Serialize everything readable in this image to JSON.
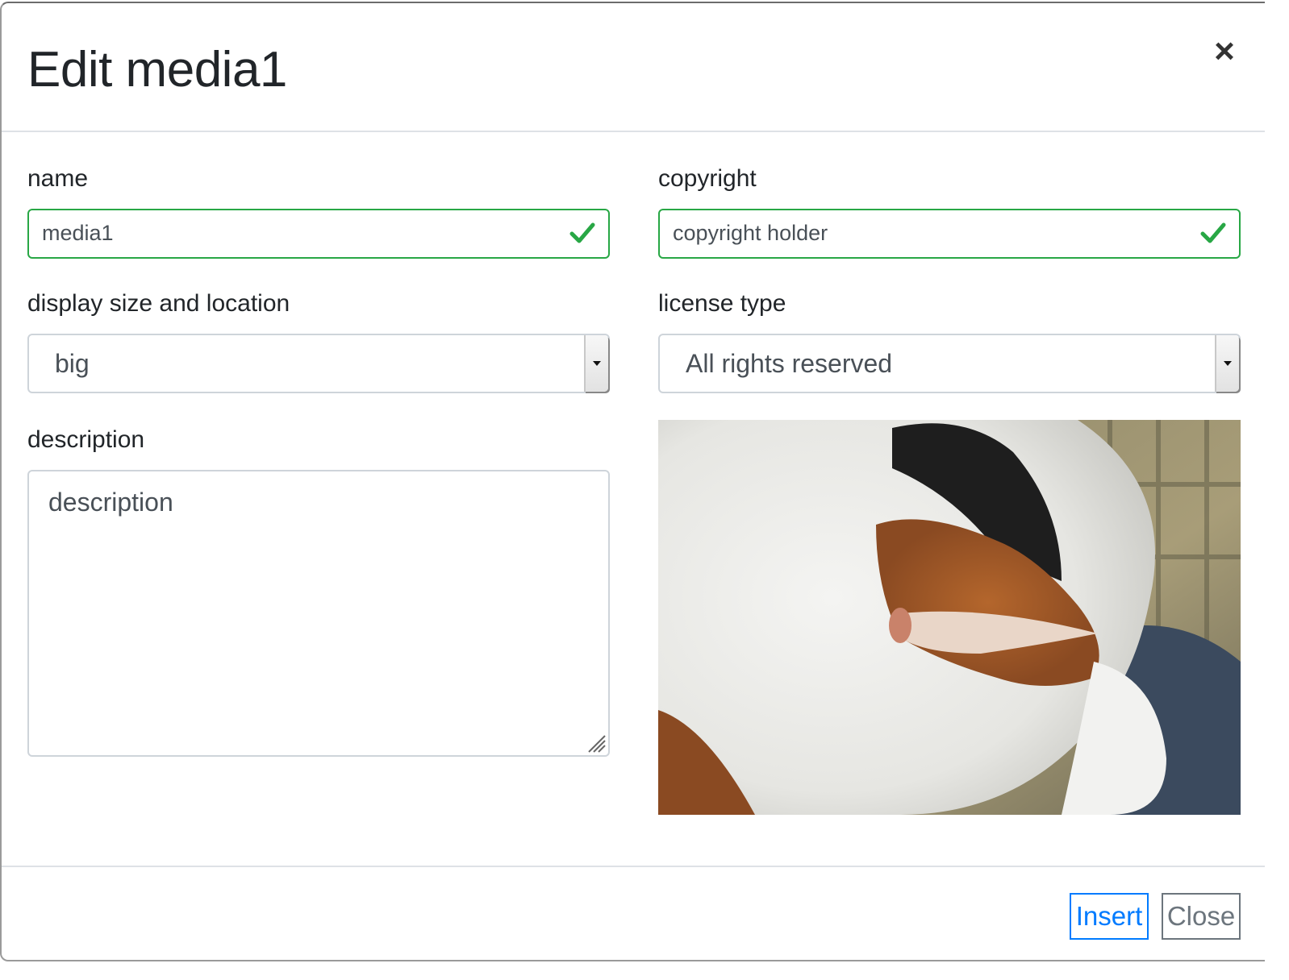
{
  "modal": {
    "title": "Edit media1",
    "close_icon": "close-icon"
  },
  "form": {
    "name": {
      "label": "name",
      "value": "media1",
      "status": "valid"
    },
    "copyright": {
      "label": "copyright",
      "value": "copyright holder",
      "status": "valid"
    },
    "display_size": {
      "label": "display size and location",
      "selected": "big"
    },
    "license_type": {
      "label": "license type",
      "selected": "All rights reserved"
    },
    "description": {
      "label": "description",
      "placeholder": "description"
    }
  },
  "preview": {
    "subject": "calico cat photo"
  },
  "footer": {
    "insert_label": "Insert",
    "close_label": "Close"
  },
  "colors": {
    "valid": "#28a745",
    "primary": "#007bff",
    "secondary": "#6c757d"
  }
}
